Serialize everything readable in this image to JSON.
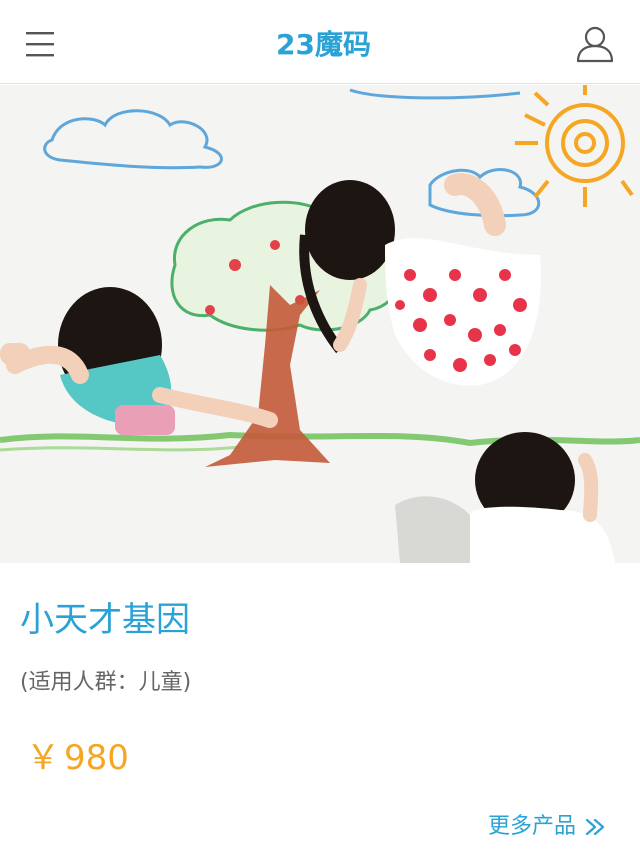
{
  "header": {
    "menu_icon": "hamburger-menu-icon",
    "logo_text": "23魔码",
    "user_icon": "user-profile-icon",
    "brand_color": "#2aa2d6"
  },
  "hero": {
    "image_description_icon": "children-drawing-image"
  },
  "product": {
    "title": "小天才基因",
    "audience": "(适用人群：儿童)",
    "currency": "￥",
    "price": "980",
    "price_color": "#f5a623"
  },
  "footer": {
    "more_label": "更多产品",
    "more_icon": "double-chevron-right-icon"
  }
}
